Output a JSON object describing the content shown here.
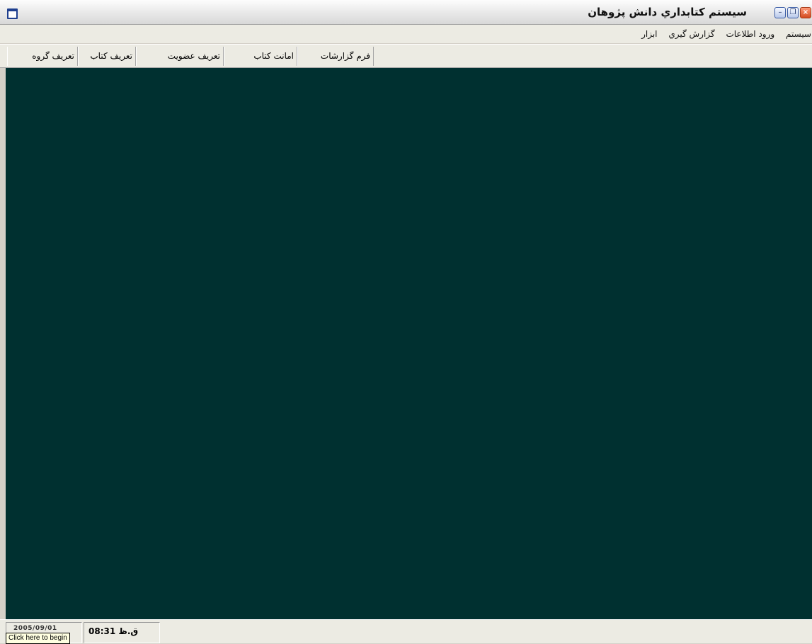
{
  "window": {
    "title": "سيستم كتابداري دانش پژوهان",
    "close_glyph": "×",
    "restore_glyph": "❐",
    "minimize_glyph": "–"
  },
  "menu": {
    "items": [
      "سيستم",
      "ورود اطلاعات",
      "گزارش گيري",
      "ابزار"
    ]
  },
  "toolbar": {
    "buttons": [
      "فرم گزارشات",
      "امانت كتاب",
      "تعريف عضويت",
      "تعريف كتاب",
      "تعريف گروه"
    ]
  },
  "statusbar": {
    "date": "2005/09/01",
    "tooltip": "Click here to begin",
    "time": "ق.ظ 08:31"
  },
  "colors": {
    "workspace": "#003030",
    "chrome": "#ecebe3"
  },
  "icons": {
    "app": "window-icon",
    "close": "close-icon",
    "restore": "restore-icon",
    "minimize": "minimize-icon"
  }
}
